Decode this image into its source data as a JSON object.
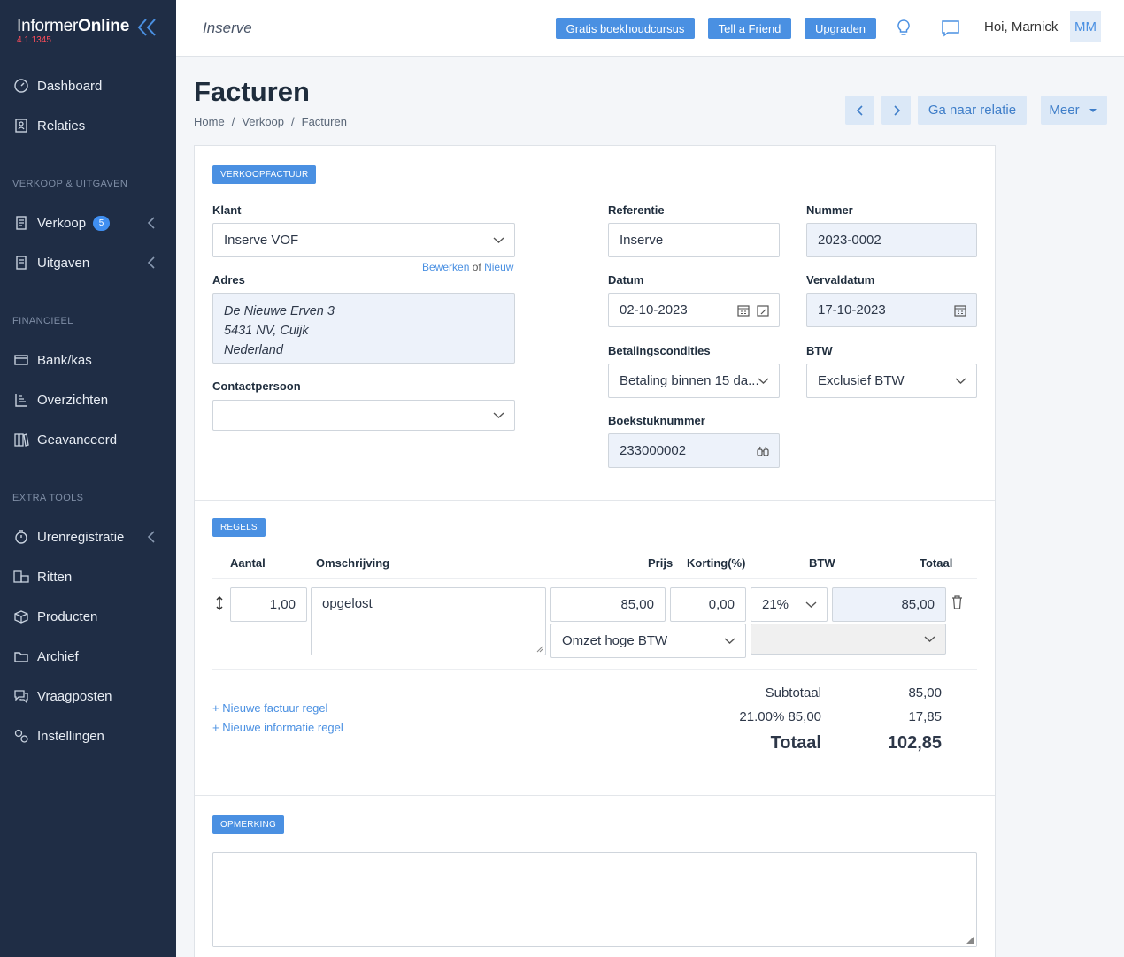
{
  "app": {
    "brand_normal": "Informer",
    "brand_bold": "Online",
    "version": "4.1.1345"
  },
  "sidebar": {
    "items_top": [
      {
        "label": "Dashboard",
        "icon": "dashboard-icon"
      },
      {
        "label": "Relaties",
        "icon": "contacts-icon"
      }
    ],
    "section_sales": "VERKOOP & UITGAVEN",
    "verkoop": {
      "label": "Verkoop",
      "badge": "5"
    },
    "uitgaven": {
      "label": "Uitgaven"
    },
    "section_finance": "FINANCIEEL",
    "finance_items": [
      {
        "label": "Bank/kas",
        "icon": "bank-icon"
      },
      {
        "label": "Overzichten",
        "icon": "reports-icon"
      },
      {
        "label": "Geavanceerd",
        "icon": "books-icon"
      }
    ],
    "section_tools": "EXTRA TOOLS",
    "tools_items": [
      {
        "label": "Urenregistratie",
        "icon": "stopwatch-icon"
      },
      {
        "label": "Ritten",
        "icon": "car-icon"
      },
      {
        "label": "Producten",
        "icon": "box-icon"
      },
      {
        "label": "Archief",
        "icon": "folder-icon"
      },
      {
        "label": "Vraagposten",
        "icon": "chat-icon"
      },
      {
        "label": "Instellingen",
        "icon": "settings-icon"
      }
    ]
  },
  "topbar": {
    "company": "Inserve",
    "btn_course": "Gratis boekhoudcursus",
    "btn_friend": "Tell a Friend",
    "btn_upgrade": "Upgraden",
    "greeting": "Hoi, Marnick",
    "avatar": "MM"
  },
  "page": {
    "title": "Facturen",
    "breadcrumb": [
      "Home",
      "Verkoop",
      "Facturen"
    ],
    "btn_relation": "Ga naar relatie",
    "btn_more": "Meer"
  },
  "invoice": {
    "pill": "VERKOOPFACTUUR",
    "klant_label": "Klant",
    "klant_value": "Inserve VOF",
    "edit_link": "Bewerken",
    "or_text": "of",
    "new_link": "Nieuw",
    "adres_label": "Adres",
    "adres_lines": [
      "De Nieuwe Erven 3",
      "5431 NV, Cuijk",
      "Nederland"
    ],
    "contact_label": "Contactpersoon",
    "contact_value": "",
    "ref_label": "Referentie",
    "ref_value": "Inserve",
    "nummer_label": "Nummer",
    "nummer_value": "2023-0002",
    "datum_label": "Datum",
    "datum_value": "02-10-2023",
    "verval_label": "Vervaldatum",
    "verval_value": "17-10-2023",
    "cond_label": "Betalingscondities",
    "cond_value": "Betaling binnen 15 da...",
    "btw_label": "BTW",
    "btw_value": "Exclusief BTW",
    "boek_label": "Boekstuknummer",
    "boek_value": "233000002"
  },
  "lines": {
    "pill": "REGELS",
    "headers": {
      "aantal": "Aantal",
      "omschrijving": "Omschrijving",
      "prijs": "Prijs",
      "korting": "Korting(%)",
      "btw": "BTW",
      "totaal": "Totaal"
    },
    "row": {
      "aantal": "1,00",
      "omschrijving": "opgelost",
      "prijs": "85,00",
      "korting": "0,00",
      "btw": "21%",
      "totaal": "85,00",
      "omzet": "Omzet hoge BTW",
      "extra": ""
    },
    "add_invoice_line": "+ Nieuwe factuur regel",
    "add_info_line": "+ Nieuwe informatie regel",
    "subtotal_label": "Subtotaal",
    "subtotal_value": "85,00",
    "vat_label": "21.00% 85,00",
    "vat_value": "17,85",
    "total_label": "Totaal",
    "total_value": "102,85"
  },
  "remark": {
    "pill": "OPMERKING",
    "value": ""
  },
  "colors": {
    "sidebar": "#1f2d45",
    "accent": "#4a90e2",
    "version": "#ff4d5a"
  }
}
